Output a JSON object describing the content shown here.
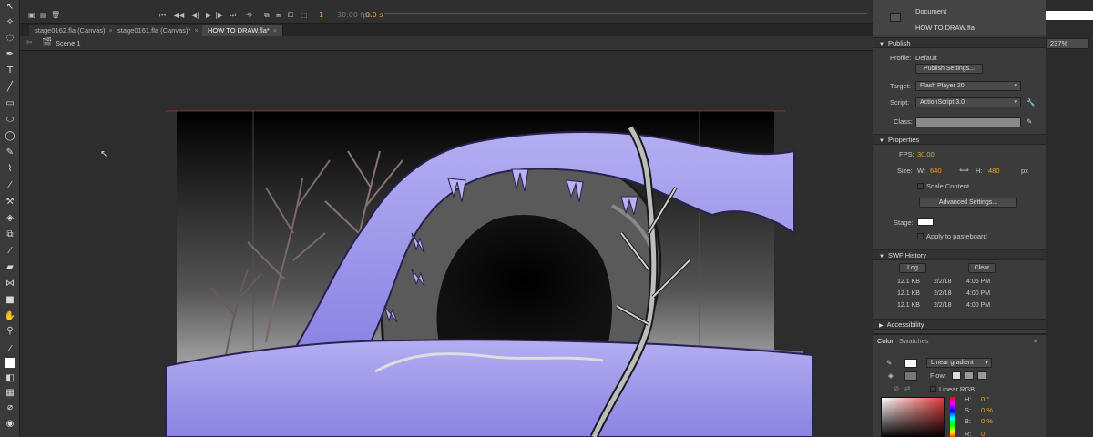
{
  "timeline": {
    "frame": "1",
    "fps": "30.00 fps",
    "time": "0.0 s"
  },
  "tabs": [
    {
      "label": "stage0162.fla (Canvas)",
      "close": "×"
    },
    {
      "label": "stage0161.fla (Canvas)*",
      "close": "×"
    },
    {
      "label": "HOW TO DRAW.fla*",
      "close": "×"
    }
  ],
  "scene": {
    "label": "Scene 1"
  },
  "zoom": "237%",
  "panel": {
    "doc_type": "Document",
    "doc_name": "HOW TO DRAW.fla",
    "publish": {
      "header": "Publish",
      "profile_label": "Profile:",
      "profile_value": "Default",
      "publish_settings": "Publish Settings...",
      "target_label": "Target:",
      "target_value": "Flash Player 20",
      "script_label": "Script:",
      "script_value": "ActionScript 3.0",
      "class_label": "Class:"
    },
    "properties": {
      "header": "Properties",
      "fps_label": "FPS:",
      "fps_value": "30.00",
      "size_label": "Size:",
      "w_label": "W:",
      "w_value": "640",
      "h_label": "H:",
      "h_value": "480",
      "unit": "px",
      "scale_content": "Scale Content",
      "advanced_settings": "Advanced Settings...",
      "stage_label": "Stage:",
      "apply_pasteboard": "Apply to pasteboard"
    },
    "swf_history": {
      "header": "SWF History",
      "log": "Log",
      "clear": "Clear",
      "rows": [
        {
          "size": "12.1 KB",
          "date": "2/2/18",
          "time": "4:06 PM"
        },
        {
          "size": "12.1 KB",
          "date": "2/2/18",
          "time": "4:00 PM"
        },
        {
          "size": "12.1 KB",
          "date": "2/2/18",
          "time": "4:00 PM"
        }
      ]
    },
    "accessibility": {
      "header": "Accessibility"
    },
    "color": {
      "tab_color": "Color",
      "tab_swatches": "Swatches",
      "fill_type": "Linear gradient",
      "flow_label": "Flow:",
      "linear_rgb": "Linear RGB",
      "h_label": "H:",
      "h_value": "0 °",
      "s_label": "S:",
      "s_value": "0 %",
      "b_label": "B:",
      "b_value": "0 %",
      "r_label": "R:",
      "r_value": "0"
    }
  },
  "colors": {
    "accent_value": "#e9a030",
    "snow": "#8f86e6",
    "stage_bg": "#000000"
  }
}
